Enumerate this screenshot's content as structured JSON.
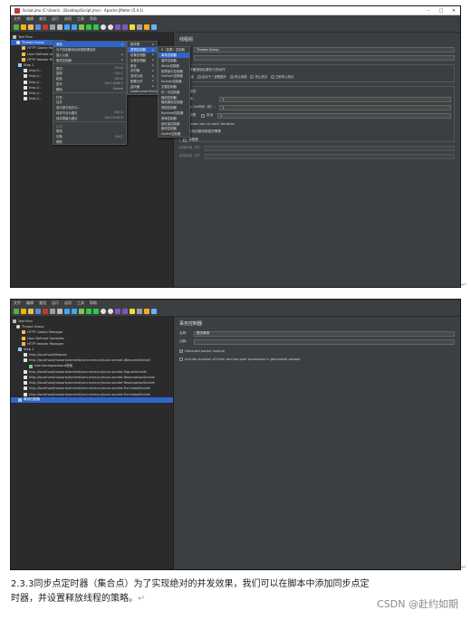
{
  "screenshot1": {
    "title": "Script.jmx (C:\\Users\\...\\Desktop\\Script.jmx) - Apache JMeter (5.4.1)",
    "menu": [
      "文件",
      "编辑",
      "查找",
      "运行",
      "选项",
      "工具",
      "帮助"
    ],
    "tree": [
      "Test Plan",
      "Thread Group",
      "HTTP Cookie Manager",
      "User Defined Variables",
      "HTTP Header Manager",
      "Step 1",
      "http://...",
      "http://...",
      "http://...",
      "http://...",
      "http://...",
      "http://..."
    ],
    "context_menu": [
      {
        "label": "添加",
        "arrow": "▸",
        "hl": true
      },
      {
        "label": "为子控制器添加参数配置组件"
      },
      {
        "label": "插入父级",
        "arrow": "▸"
      },
      {
        "label": "更改控制器",
        "arrow": "▸"
      },
      {
        "label": "剪切",
        "sc": "Ctrl-X"
      },
      {
        "label": "复制",
        "sc": "Ctrl-C"
      },
      {
        "label": "粘贴",
        "sc": "Ctrl-V"
      },
      {
        "label": "复写",
        "sc": "Ctrl+Shift-C"
      },
      {
        "label": "删除",
        "sc": "Delete"
      },
      {
        "label": "打开..."
      },
      {
        "label": "合并"
      },
      {
        "label": "选中部分保存为..."
      },
      {
        "label": "保存节点为图片",
        "sc": "Ctrl-G"
      },
      {
        "label": "保存屏幕为图片",
        "sc": "Ctrl+Shift-G"
      },
      {
        "label": "启用",
        "dis": true
      },
      {
        "label": "禁用"
      },
      {
        "label": "切换",
        "sc": "Ctrl-T"
      },
      {
        "label": "帮助"
      }
    ],
    "submenu1": [
      {
        "label": "取样器",
        "arrow": "▸"
      },
      {
        "label": "逻辑控制器",
        "arrow": "▸",
        "hl": true
      },
      {
        "label": "前置处理器",
        "arrow": "▸"
      },
      {
        "label": "后置处理器",
        "arrow": "▸"
      },
      {
        "label": "断言",
        "arrow": "▸"
      },
      {
        "label": "定时器",
        "arrow": "▸"
      },
      {
        "label": "测试片段",
        "arrow": "▸"
      },
      {
        "label": "配置元件",
        "arrow": "▸"
      },
      {
        "label": "监听器",
        "arrow": "▸"
      },
      {
        "label": "Loadrunner.Purchase"
      }
    ],
    "submenu2": [
      {
        "label": "If（如果）控制器"
      },
      {
        "label": "事务控制器",
        "hl": true
      },
      {
        "label": "循环控制器"
      },
      {
        "label": "While控制器"
      },
      {
        "label": "临界部分控制器"
      },
      {
        "label": "ForEach控制器"
      },
      {
        "label": "Include控制器"
      },
      {
        "label": "交替控制器"
      },
      {
        "label": "仅一次控制器"
      },
      {
        "label": "随机控制器"
      },
      {
        "label": "随机顺序控制器"
      },
      {
        "label": "录制控制器"
      },
      {
        "label": "Runtime控制器"
      },
      {
        "label": "简单控制器"
      },
      {
        "label": "吞吐量控制器"
      },
      {
        "label": "模块控制器"
      },
      {
        "label": "Switch控制器"
      }
    ],
    "panel": {
      "title": "线程组",
      "name_label": "名称：",
      "name_value": "Thread Group",
      "comment_label": "注释：",
      "error_label": "在取样器错误后要执行的动作",
      "error_options": [
        "继续",
        "启动下一进程循环",
        "停止线程",
        "停止测试",
        "立即停止测试"
      ],
      "props_label": "线程属性",
      "threads_label": "线程数：",
      "threads_value": "1",
      "rampup_label": "Ramp-Up时间（秒）：",
      "rampup_value": "1",
      "loop_label": "循环次数",
      "loop_forever": "永远",
      "loop_value": "1",
      "same_user": "Same user on each iteration",
      "delay": "延迟创建线程直到需要",
      "scheduler": "调度器",
      "duration_label": "持续时间（秒）",
      "startup_label": "启动延迟（秒）"
    }
  },
  "screenshot2": {
    "menu": [
      "文件",
      "编辑",
      "查找",
      "运行",
      "选项",
      "工具",
      "帮助"
    ],
    "tree": [
      "Test Plan",
      "Thread Group",
      "HTTP Cookie Manager",
      "User Defined Variables",
      "HTTP Header Manager",
      "Step 1",
      "http://localhost/Mosoris",
      "http://localhost/mosoris/servlet/com.mercurytours.servlet.WelcomeServlet",
      "usernamepassword获取",
      "http://localhost/mosoris/servlet/com.mercurytours.servlet.SignonServlet",
      "http://localhost/mosoris/servlet/com.mercurytours.servlet.ReservationServlet",
      "http://localhost/mosoris/servlet/com.mercurytours.servlet.ReservationServlet",
      "http://localhost/mosoris/servlet/com.mercurytours.servlet.PurchaseServlet",
      "http://localhost/mosoris/servlet/com.mercurytours.servlet.PurchaseServlet",
      "事务控制器"
    ],
    "panel": {
      "title": "事务控制器",
      "name_label": "名称：",
      "name_value": "提交事务",
      "comment_label": "注释：",
      "gen_parent": "Generate parent sample",
      "include_duration": "Include duration of timer and pre-post processors in generated sample"
    }
  },
  "caption": {
    "line1": "2.3.3同步点定时器（集合点）为了实现绝对的并发效果，我们可以在脚本中添加同步点定",
    "line2": "时器，并设置释放线程的策略。",
    "para_mark": "↵"
  },
  "watermark": "CSDN @赴约如期",
  "colors": {
    "accent": "#2f65ca",
    "panel": "#3c3f41",
    "tree_bg": "#2b2b2b"
  }
}
